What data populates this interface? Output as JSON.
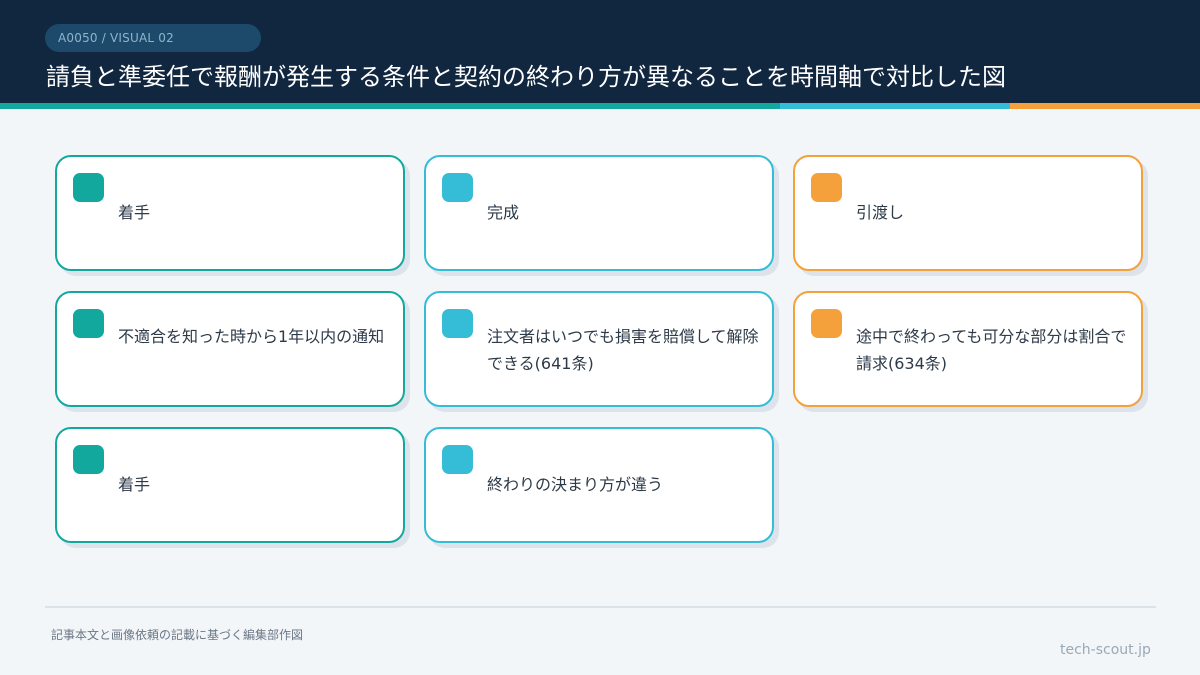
{
  "header": {
    "badge": "A0050 / VISUAL 02",
    "title": "請負と準委任で報酬が発生する条件と契約の終わり方が異なることを時間軸で対比した図"
  },
  "cards": [
    {
      "text": "着手",
      "accent": "teal"
    },
    {
      "text": "完成",
      "accent": "cyan"
    },
    {
      "text": "引渡し",
      "accent": "orange"
    },
    {
      "text": "不適合を知った時から1年以内の通知",
      "accent": "teal"
    },
    {
      "text": "注文者はいつでも損害を賠償して解除できる(641条)",
      "accent": "cyan"
    },
    {
      "text": "途中で終わっても可分な部分は割合で請求(634条)",
      "accent": "orange"
    },
    {
      "text": "着手",
      "accent": "teal"
    },
    {
      "text": "終わりの決まり方が違う",
      "accent": "cyan"
    }
  ],
  "footer": {
    "note": "記事本文と画像依頼の記載に基づく編集部作図",
    "site": "tech-scout.jp"
  },
  "colors": {
    "header_bg": "#11263f",
    "teal": "#13a89e",
    "cyan": "#35bcd6",
    "orange": "#f4a03b",
    "background": "#f3f6f9"
  }
}
